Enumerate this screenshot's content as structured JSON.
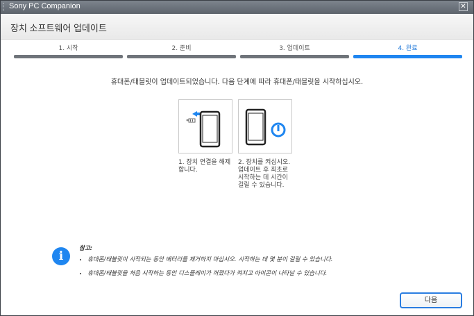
{
  "window": {
    "title": "Sony PC Companion",
    "close_glyph": "✕"
  },
  "header": {
    "title": "장치 소프트웨어 업데이트"
  },
  "steps": [
    {
      "label": "1. 시작",
      "active": false
    },
    {
      "label": "2. 준비",
      "active": false
    },
    {
      "label": "3. 업데이트",
      "active": false
    },
    {
      "label": "4. 완료",
      "active": true
    }
  ],
  "message": "휴대폰/태블릿이 업데이트되었습니다. 다음 단계에 따라 휴대폰/태블릿을 시작하십시오.",
  "instructions": [
    {
      "caption": "1. 장치 연결을 해제합니다.",
      "icon": "disconnect-phone-icon"
    },
    {
      "caption": "2. 장치를 켜십시오. 업데이트 후 최초로 시작하는 데 시간이 걸릴 수 있습니다.",
      "icon": "power-on-phone-icon"
    }
  ],
  "note": {
    "title": "참고:",
    "items": [
      "휴대폰/태블릿이 시작되는 동안 배터리를 제거하지 마십시오. 시작하는 데 몇 분이 걸릴 수 있습니다.",
      "휴대폰/태블릿을 처음 시작하는 동안 디스플레이가 꺼졌다가 켜지고 아이콘이 나타날 수 있습니다."
    ],
    "icon_glyph": "i"
  },
  "buttons": {
    "next": "다음"
  },
  "colors": {
    "accent": "#1f86f0",
    "titlebar": "#6b7179",
    "inactive_step": "#6f747a"
  }
}
